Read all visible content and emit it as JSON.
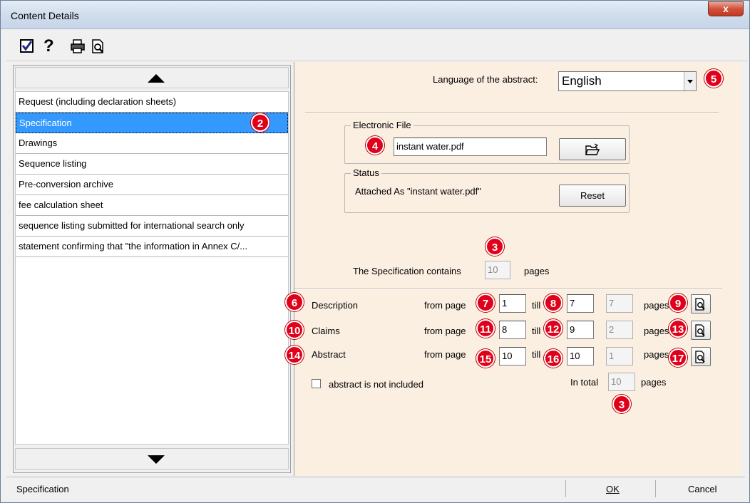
{
  "window": {
    "title": "Content Details",
    "close_glyph": "x"
  },
  "toolbar": {
    "icons": [
      "checkbox-icon",
      "help-icon",
      "print-icon",
      "print-preview-icon"
    ],
    "help_glyph": "?"
  },
  "document_list": {
    "items": [
      "Request (including declaration sheets)",
      "Specification",
      "Drawings",
      "Sequence listing",
      "Pre-conversion archive",
      "fee calculation sheet",
      "sequence listing submitted for international search only",
      "statement confirming that \"the information in Annex C/..."
    ],
    "selected_index": 1
  },
  "language": {
    "label": "Language of the abstract:",
    "value": "English"
  },
  "electronic_file": {
    "title": "Electronic File",
    "filename": "instant water.pdf"
  },
  "status": {
    "title": "Status",
    "text": "Attached As \"instant water.pdf\"",
    "reset_label": "Reset"
  },
  "specification": {
    "contains_label": "The Specification contains",
    "pages_value": "10",
    "pages_label": "pages"
  },
  "sections": [
    {
      "name": "Description",
      "from_label": "from page",
      "from": "1",
      "till_label": "till",
      "till": "7",
      "pages": "7",
      "pages_label": "pages"
    },
    {
      "name": "Claims",
      "from_label": "from page",
      "from": "8",
      "till_label": "till",
      "till": "9",
      "pages": "2",
      "pages_label": "pages"
    },
    {
      "name": "Abstract",
      "from_label": "from page",
      "from": "10",
      "till_label": "till",
      "till": "10",
      "pages": "1",
      "pages_label": "pages"
    }
  ],
  "abstract_not_included": {
    "label": "abstract is not included",
    "checked": false
  },
  "total": {
    "label": "In total",
    "value": "10",
    "pages_label": "pages"
  },
  "badges": {
    "b2": "2",
    "b3a": "3",
    "b3b": "3",
    "b4": "4",
    "b5": "5",
    "b6": "6",
    "b7": "7",
    "b8": "8",
    "b9": "9",
    "b10": "10",
    "b11": "11",
    "b12": "12",
    "b13": "13",
    "b14": "14",
    "b15": "15",
    "b16": "16",
    "b17": "17"
  },
  "statusbar": {
    "text": "Specification",
    "ok_label": "OK",
    "cancel_label": "Cancel"
  },
  "colors": {
    "right_panel_bg": "#fbefe2",
    "selection": "#3399ff",
    "badge": "#e0001a"
  }
}
